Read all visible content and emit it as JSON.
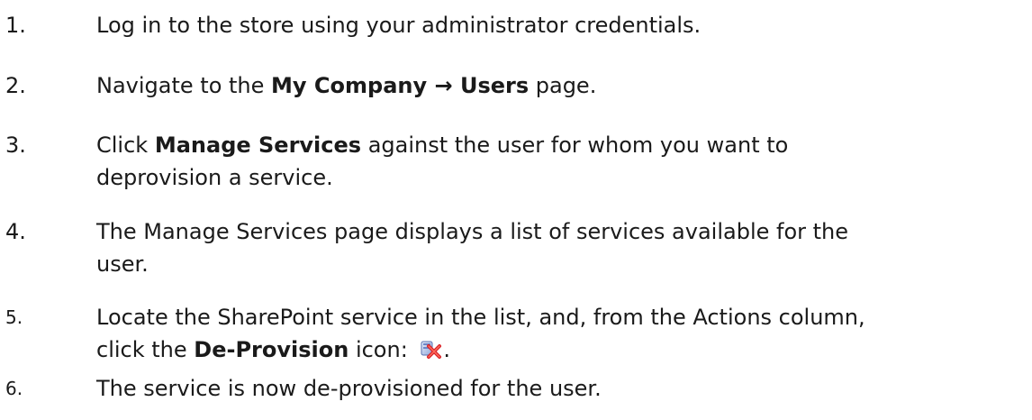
{
  "steps": [
    {
      "number": "1.",
      "text": "Log in to the store using your administrator credentials."
    },
    {
      "number": "2.",
      "pre": "Navigate to the ",
      "bold_1": "My Company",
      "arrow": " → ",
      "bold_2": "Users",
      "post": " page."
    },
    {
      "number": "3.",
      "pre": "Click ",
      "bold": "Manage Services",
      "line1_post": " against the user for whom you want to",
      "line2": "deprovision a service."
    },
    {
      "number": "4.",
      "line1": "The Manage Services page displays a list of services available for the",
      "line2": "user."
    },
    {
      "number": "5.",
      "line1": "Locate the SharePoint service in the list, and, from the Actions column,",
      "pre": "click the ",
      "bold": "De-Provision",
      "post_icon": " icon: ",
      "end": ".",
      "icon": "de-provision-icon"
    },
    {
      "number": "6.",
      "text": "The service is now de-provisioned for the user."
    }
  ]
}
